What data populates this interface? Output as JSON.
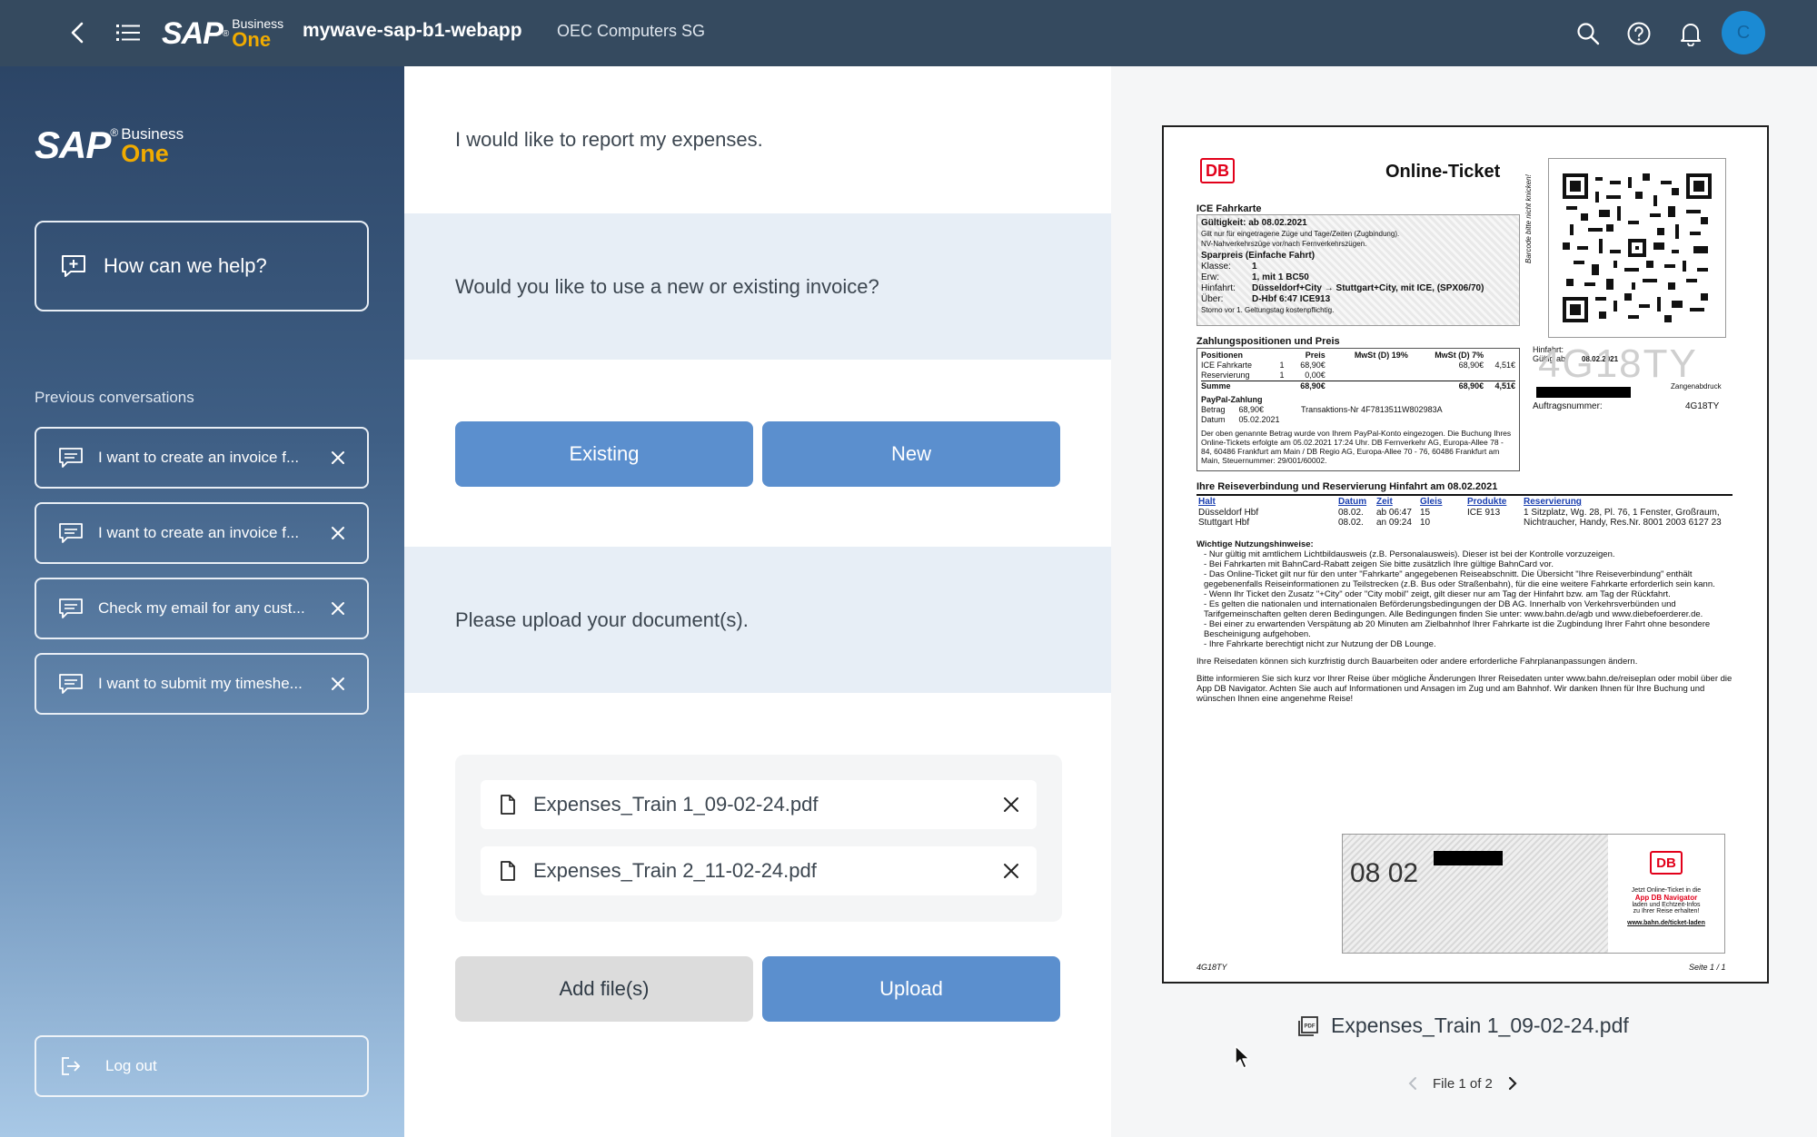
{
  "shell": {
    "app_title": "mywave-sap-b1-webapp",
    "company": "OEC Computers SG",
    "avatar_initial": "C"
  },
  "brand": {
    "sap": "SAP",
    "reg": "®",
    "business": "Business",
    "one": "One",
    "one_color": "#f0ab00"
  },
  "sidebar": {
    "help_label": "How can we help?",
    "previous_title": "Previous conversations",
    "conversations": [
      {
        "label": "I want to create an invoice f..."
      },
      {
        "label": "I want to create an invoice f..."
      },
      {
        "label": "Check my email for any cust..."
      },
      {
        "label": "I want to submit my timeshe..."
      }
    ],
    "logout_label": "Log out"
  },
  "chat": {
    "msg_user_1": "I would like to report my expenses.",
    "msg_bot_1": "Would you like to use a new or existing invoice?",
    "btn_existing": "Existing",
    "btn_new": "New",
    "msg_bot_2": "Please upload your document(s).",
    "files": [
      {
        "name": "Expenses_Train 1_09-02-24.pdf"
      },
      {
        "name": "Expenses_Train 2_11-02-24.pdf"
      }
    ],
    "btn_add": "Add file(s)",
    "btn_upload": "Upload",
    "accent_color": "#5b8fce"
  },
  "preview": {
    "file_name": "Expenses_Train 1_09-02-24.pdf",
    "pager": "File 1 of 2",
    "doc": {
      "db": "DB",
      "title": "Online-Ticket",
      "section_ticket": "ICE Fahrkarte",
      "validity": "Gültigkeit: ab 08.02.2021",
      "validity_note1": "Gilt nur für eingetragene Züge und Tage/Zeiten (Zugbindung).",
      "validity_note2": "NV-Nahverkehrszüge vor/nach Fernverkehrszügen.",
      "fare": "Sparpreis (Einfache Fahrt)",
      "klasse_k": "Klasse:",
      "klasse_v": "1",
      "erw_k": "Erw:",
      "erw_v": "1, mit 1 BC50",
      "hinfahrt_k": "Hinfahrt:",
      "hinfahrt_v": "Düsseldorf+City → Stuttgart+City, mit ICE, (SPX06/70)",
      "ueber_k": "Über:",
      "ueber_v": "D-Hbf 6:47 ICE913",
      "storno": "Storno vor 1. Geltungstag kostenpflichtig.",
      "barcode_note": "Barcode bitte nicht knicken!",
      "section_pay": "Zahlungspositionen und Preis",
      "pay_head": [
        "Positionen",
        "",
        "Preis",
        "MwSt (D) 19%",
        "MwSt (D) 7%",
        ""
      ],
      "pay_rows": [
        [
          "ICE Fahrkarte",
          "1",
          "68,90€",
          "",
          "68,90€",
          "4,51€"
        ],
        [
          "Reservierung",
          "1",
          "0,00€",
          "",
          "",
          ""
        ],
        [
          "Summe",
          "",
          "68,90€",
          "",
          "68,90€",
          "4,51€"
        ]
      ],
      "paypal": "PayPal-Zahlung",
      "betrag": "Betrag      68,90€",
      "transaktion": "Transaktions-Nr  4F7813511W802983A",
      "datum": "Datum      05.02.2021",
      "pay_text": "Der oben genannte Betrag wurde von Ihrem PayPal-Konto eingezogen. Die Buchung Ihres Online-Tickets erfolgte am 05.02.2021 17:24 Uhr. DB Fernverkehr AG, Europa-Allee 78 - 84, 60486 Frankfurt am Main / DB Regio AG, Europa-Allee 70 - 76, 60486 Frankfurt am Main, Steuernummer: 29/001/60002.",
      "hinfahrt_label": "Hinfahrt:",
      "gueltig_label": "Gültig ab:",
      "gueltig_date": "08.02.2021",
      "code_big": "4G18TY",
      "zangen": "Zangenabdruck",
      "auftrag_k": "Auftragsnummer:",
      "auftrag_v": "4G18TY",
      "conn_title": "Ihre Reiseverbindung und Reservierung Hinfahrt am 08.02.2021",
      "conn_head": [
        "Halt",
        "Datum",
        "Zeit",
        "Gleis",
        "Produkte",
        "Reservierung"
      ],
      "conn_rows": [
        [
          "Düsseldorf Hbf",
          "08.02.",
          "ab 06:47",
          "15",
          "ICE 913",
          "1 Sitzplatz, Wg. 28, Pl. 76, 1 Fenster, Großraum,"
        ],
        [
          "Stuttgart Hbf",
          "08.02.",
          "an 09:24",
          "10",
          "",
          "Nichtraucher, Handy, Res.Nr. 8001 2003 6127 23"
        ]
      ],
      "notes_title": "Wichtige Nutzungshinweise:",
      "notes": [
        "Nur gültig mit amtlichem Lichtbildausweis (z.B. Personalausweis). Dieser ist bei der Kontrolle vorzuzeigen.",
        "Bei Fahrkarten mit BahnCard-Rabatt zeigen Sie bitte zusätzlich Ihre gültige BahnCard vor.",
        "Das Online-Ticket gilt nur für den unter \"Fahrkarte\" angegebenen Reiseabschnitt. Die Übersicht \"Ihre Reiseverbindung\" enthält gegebenenfalls Reiseinformationen zu Teilstrecken (z.B. Bus oder Straßenbahn), für die eine weitere Fahrkarte erforderlich sein kann.",
        "Wenn Ihr Ticket den Zusatz \"+City\" oder \"City mobil\" zeigt, gilt dieser nur am Tag der Hinfahrt bzw. am Tag der Rückfahrt.",
        "Es gelten die nationalen und internationalen Beförderungsbedingungen der DB AG. Innerhalb von Verkehrsverbünden und Tarifgemeinschaften gelten deren Bedingungen. Alle Bedingungen finden Sie unter: www.bahn.de/agb und www.diebefoerderer.de.",
        "Bei einer zu erwartenden Verspätung ab 20 Minuten am Zielbahnhof Ihrer Fahrkarte ist die Zugbindung Ihrer Fahrt ohne besondere Bescheinigung aufgehoben.",
        "Ihre Fahrkarte berechtigt nicht zur Nutzung der DB Lounge."
      ],
      "note_para1": "Ihre Reisedaten können sich kurzfristig durch Bauarbeiten oder andere erforderliche Fahrplananpassungen ändern.",
      "note_para2": "Bitte informieren Sie sich kurz vor Ihrer Reise über mögliche Änderungen Ihrer Reisedaten unter www.bahn.de/reiseplan oder mobil über die App DB Navigator. Achten Sie auch auf Informationen und Ansagen im Zug und am Bahnhof. Wir danken Ihnen für Ihre Buchung und wünschen Ihnen eine angenehme Reise!",
      "foot_date": "08 02",
      "foot_promo1": "Jetzt Online-Ticket in die",
      "foot_promo2": "App DB Navigator",
      "foot_promo3": "laden und Echtzeit-Infos",
      "foot_promo4": "zu Ihrer Reise erhalten!",
      "foot_link": "www.bahn.de/ticket-laden",
      "foot_code": "4G18TY",
      "foot_page": "Seite 1 / 1",
      "db_red": "#e2001a"
    }
  }
}
